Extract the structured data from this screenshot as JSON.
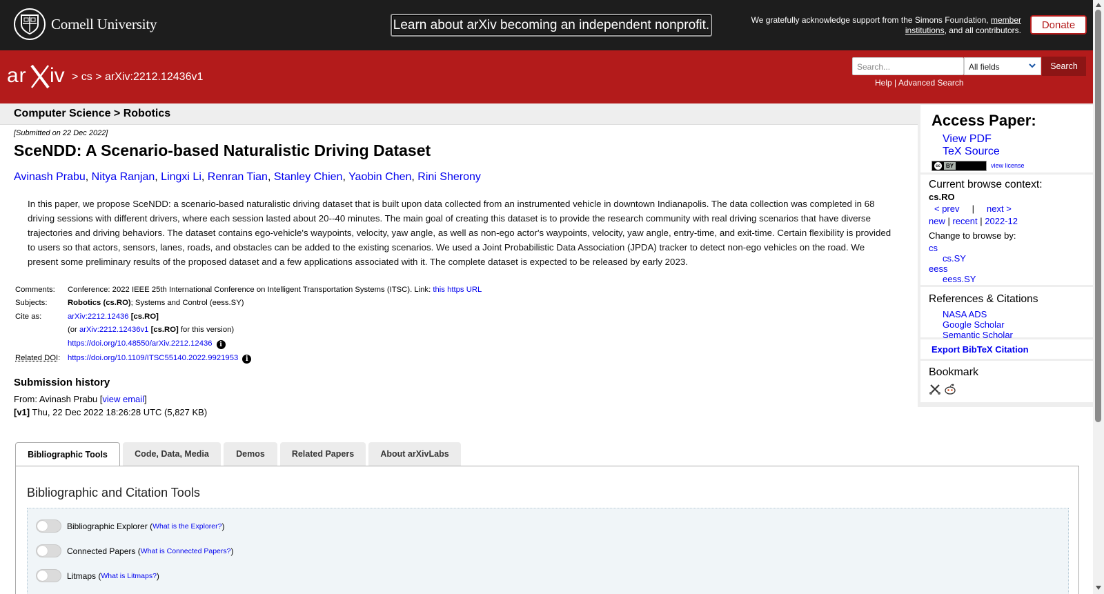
{
  "topbar": {
    "university": "Cornell University",
    "announcement": "Learn about arXiv becoming an independent nonprofit.",
    "ack_prefix": "We gratefully acknowledge support from the Simons Foundation,",
    "ack_link": "member institutions",
    "ack_suffix": ", and all contributors.",
    "donate": "Donate"
  },
  "header": {
    "crumb_sep1": ">",
    "crumb_cs": "cs",
    "crumb_sep2": ">",
    "crumb_id": "arXiv:2212.12436v1",
    "search_placeholder": "Search...",
    "search_field": "All fields",
    "search_button": "Search",
    "help": "Help",
    "sep": "|",
    "advanced": "Advanced Search"
  },
  "subheader": "Computer Science > Robotics",
  "paper": {
    "submitted": "[Submitted on 22 Dec 2022]",
    "title": "SceNDD: A Scenario-based Naturalistic Driving Dataset",
    "authors": [
      "Avinash Prabu",
      "Nitya Ranjan",
      "Lingxi Li",
      "Renran Tian",
      "Stanley Chien",
      "Yaobin Chen",
      "Rini Sherony"
    ],
    "abstract": "In this paper, we propose SceNDD: a scenario-based naturalistic driving dataset that is built upon data collected from an instrumented vehicle in downtown Indianapolis. The data collection was completed in 68 driving sessions with different drivers, where each session lasted about 20--40 minutes. The main goal of creating this dataset is to provide the research community with real driving scenarios that have diverse trajectories and driving behaviors. The dataset contains ego-vehicle's waypoints, velocity, yaw angle, as well as non-ego actor's waypoints, velocity, yaw angle, entry-time, and exit-time. Certain flexibility is provided to users so that actors, sensors, lanes, roads, and obstacles can be added to the existing scenarios. We used a Joint Probabilistic Data Association (JPDA) tracker to detect non-ego vehicles on the road. We present some preliminary results of the proposed dataset and a few applications associated with it. The complete dataset is expected to be released by early 2023.",
    "comments_label": "Comments:",
    "comments_text": "Conference: 2022 IEEE 25th International Conference on Intelligent Transportation Systems (ITSC). Link:",
    "comments_link": "this https URL",
    "subjects_label": "Subjects:",
    "subjects_primary": "Robotics (cs.RO)",
    "subjects_rest": "; Systems and Control (eess.SY)",
    "cite_label": "Cite as:",
    "cite_id": "arXiv:2212.12436",
    "cite_cat": "[cs.RO]",
    "cite_or": "(or",
    "cite_vid": "arXiv:2212.12436v1",
    "cite_vcat": "[cs.RO]",
    "cite_for": "for this version)",
    "cite_doi": "https://doi.org/10.48550/arXiv.2212.12436",
    "related_label": "Related DOI",
    "related_colon": ":",
    "related_doi": "https://doi.org/10.1109/ITSC55140.2022.9921953",
    "info_glyph": "i"
  },
  "history": {
    "title": "Submission history",
    "from": "From: Avinash Prabu [",
    "view_email": "view email",
    "from_end": "]",
    "v1": "[v1]",
    "v1_text": "Thu, 22 Dec 2022 18:26:28 UTC (5,827 KB)"
  },
  "tabs": [
    "Bibliographic Tools",
    "Code, Data, Media",
    "Demos",
    "Related Papers",
    "About arXivLabs"
  ],
  "panel": {
    "title": "Bibliographic and Citation Tools",
    "toggles": [
      {
        "label": "Bibliographic Explorer",
        "help": "What is the Explorer?"
      },
      {
        "label": "Connected Papers",
        "help": "What is Connected Papers?"
      },
      {
        "label": "Litmaps",
        "help": "What is Litmaps?"
      }
    ]
  },
  "sidebar": {
    "access_title": "Access Paper:",
    "view_pdf": "View PDF",
    "tex_source": "TeX Source",
    "cc_label": "cc",
    "cc_by": "BY",
    "view_license": "view license",
    "browse_title": "Current browse context:",
    "context": "cs.RO",
    "prev": "< prev",
    "nav_sep": "|",
    "next": "next >",
    "new": "new",
    "recent": "recent",
    "month": "2022-12",
    "change": "Change to browse by:",
    "cats": [
      "cs",
      "cs.SY",
      "eess",
      "eess.SY"
    ],
    "refs_title": "References & Citations",
    "refs": [
      "NASA ADS",
      "Google Scholar",
      "Semantic Scholar"
    ],
    "bibtex": "Export BibTeX Citation",
    "bookmark": "Bookmark"
  },
  "colors": {
    "arxiv_red": "#b31b1b",
    "link": "#0000ee",
    "topbar": "#1d1d1d"
  },
  "icons": [
    "cornell-seal-icon",
    "arxiv-logo-icon",
    "chevron-down-icon",
    "info-icon",
    "bibsonomy-icon",
    "reddit-icon"
  ]
}
